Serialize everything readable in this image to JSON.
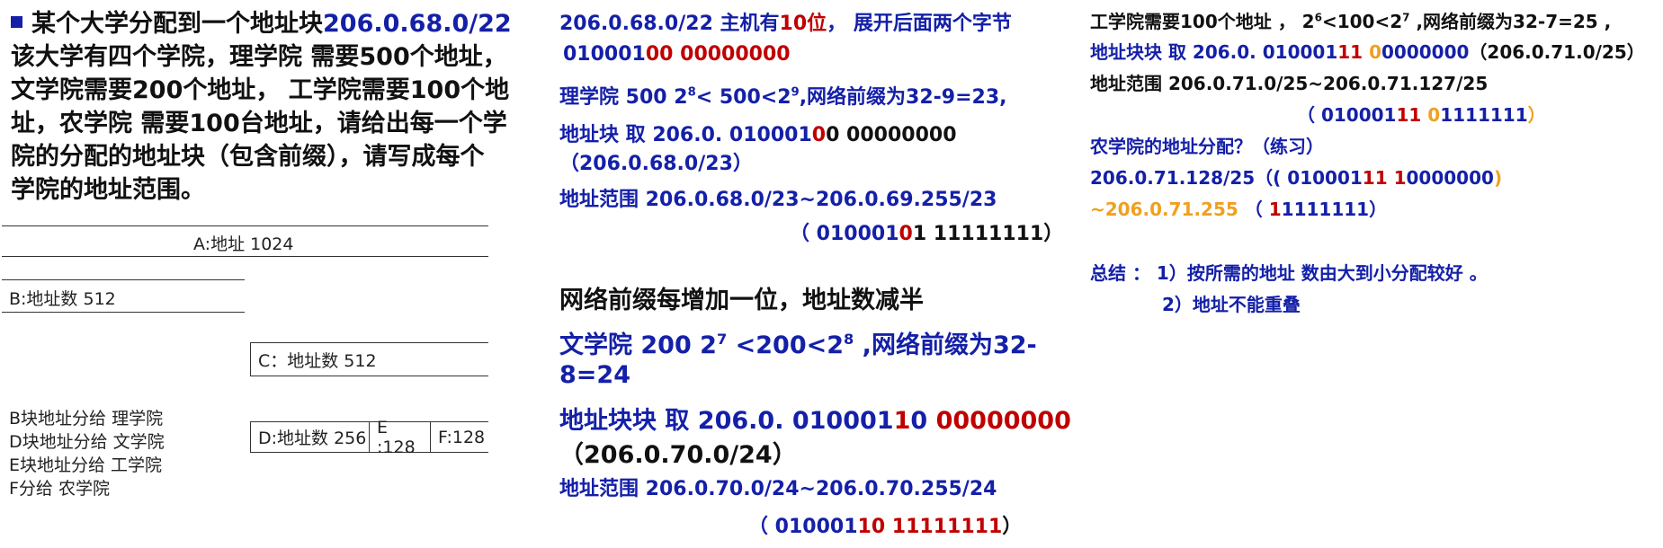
{
  "left": {
    "problem": {
      "line1_prefix": "某个大学分配到一个地址块",
      "line1_block": "206.0.68.0/22",
      "line2": "该大学有四个学院，理学院 需要500个地址，",
      "line3": "文学院需要200个地址， 工学院需要100个地",
      "line4": "址，农学院 需要100台地址，请给出每一个学",
      "line5": "院的分配的地址块（包含前缀），请写成每个",
      "line6": "学院的地址范围。"
    },
    "diagram": {
      "a_label": "A:地址 1024",
      "b_label": "B:地址数 512",
      "c_label": "C：地址数 512",
      "d_label": "D:地址数 256",
      "e_label": "E :128",
      "f_label": "F:128"
    },
    "notes": [
      "B块地址分给 理学院",
      "D块地址分给 文学院",
      "E块地址分给 工学院",
      "F分给  农学院"
    ]
  },
  "middle": {
    "l1_a": "206.0.68.0/22  主机有",
    "l1_b": "10位",
    "l1_c": "， 展开后面两个字节",
    "l2_a": "010001",
    "l2_b": "00 00000000",
    "l3_a": "理学院 500  2",
    "l3_sup1": "8",
    "l3_b": "< 500<2",
    "l3_sup2": "9",
    "l3_c": ",网络前缀为32-9=23,",
    "l4_a": "地址块  取 206.0. 010001",
    "l4_b": "0",
    "l4_c": "0 00000000",
    "l5": "（206.0.68.0/23）",
    "l6": "地址范围 206.0.68.0/23~206.0.69.255/23",
    "l7_a": "（ 010001",
    "l7_b": "0",
    "l7_c": "1  11111111）",
    "h1": "网络前缀每增加一位，地址数减半",
    "h2_a": "文学院 200   2",
    "h2_sup1": "7",
    "h2_b": " <200<2",
    "h2_sup2": "8",
    "h2_c": " ,网络前缀为32-",
    "h3": "8=24",
    "h4_a": "地址块块  取 206.0. 010001",
    "h4_b": "1",
    "h4_c": "0 ",
    "h4_d": "00000000",
    "h5": "（206.0.70.0/24）",
    "h6": "地址范围 206.0.70.0/24~206.0.70.255/24",
    "h7_a": "（ 010001",
    "h7_b": "10",
    "h7_c": "  11111111",
    "h7_d": "）"
  },
  "right": {
    "r1_a": "工学院需要100个地址 ，  2",
    "r1_sup1": "6",
    "r1_b": "<100<2",
    "r1_sup2": "7",
    "r1_c": " ,网络前缀为32-7=25 ,",
    "r2_a": "地址块块  取 206.0. 010001",
    "r2_b": "11",
    "r2_c": " ",
    "r2_d": "0",
    "r2_e": "0000000",
    "r2_f": "（206.0.71.0/25）",
    "r3": "地址范围  206.0.71.0/25~206.0.71.127/25",
    "r4_a": "（ 010001",
    "r4_b": "11",
    "r4_c": " ",
    "r4_d": "0",
    "r4_e": "1111111",
    "r4_f": "）",
    "r5": "农学院的地址分配？（练习）",
    "r6_a": " 206.0.71.128/25（( 010001",
    "r6_b": "11",
    "r6_c": " ",
    "r6_d": "1",
    "r6_e": "0000000",
    "r6_f": ")",
    "r7_a": "~206.0.71.255",
    "r7_b": "  （ ",
    "r7_c": "1",
    "r7_d": "1111111",
    "r7_e": "）",
    "s1": "总结 ：  1）按所需的地址  数由大到小分配较好  。",
    "s2": "2）地址不能重叠"
  }
}
